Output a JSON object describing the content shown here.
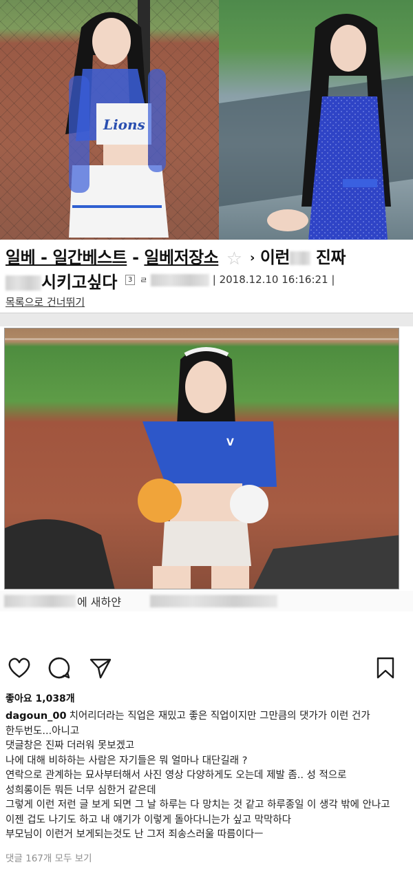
{
  "post_header": {
    "breadcrumb": [
      "일베 - 일간베스트",
      "일베저장소"
    ],
    "breadcrumb_separator": " - ",
    "breadcrumb_arrow": "›",
    "title_part1": "이런",
    "title_part2": "진짜",
    "title_line2": "시키고싶다",
    "level_badge": "3",
    "author_icon": "ㄹ",
    "datetime": "| 2018.12.10 16:16:21 |",
    "skip_link": "목록으로 건너뛰기",
    "star_icon": "star-icon"
  },
  "main_caption": {
    "text": "에 새하얀"
  },
  "instagram": {
    "icons": [
      "heart-icon",
      "comment-icon",
      "share-icon",
      "bookmark-icon"
    ],
    "likes": "좋아요 1,038개",
    "username": "dagoun_00",
    "caption_lines": [
      "치어리더라는 직업은 재밌고 좋은 직업이지만 그만큼의 댓가가 이런 건가",
      "한두번도...아니고",
      "댓글창은 진짜 더러워 못보겠고",
      "나에 대해 비하하는 사람은 자기들은 뭐 얼마나 대단길래 ?",
      "연락으로 관계하는 묘사부터해서 사진 영상 다양하게도 오는데 제발 좀.. 성 적으로",
      "성희롱이든 뭐든 너무 심한거 같은데",
      "그렇게 이런 저런 글 보게 되면 그 날 하루는 다 망치는 것 같고 하루종일 이 생각 밖에 안나고",
      "이젠 겁도 나기도 하고 내 얘기가 이렇게 돌아다니는가 싶고 막막하다",
      "부모님이 이런거 보게되는것도 난 그저 죄송스러울 따름이다ㅡ"
    ],
    "view_comments": "댓글 167개 모두 보기"
  }
}
